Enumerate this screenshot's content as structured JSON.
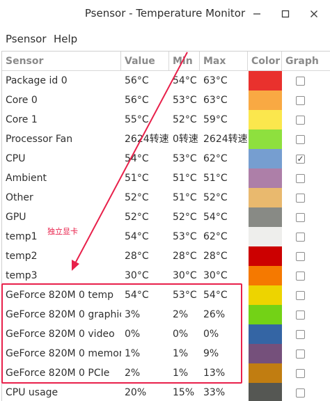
{
  "window": {
    "title": "Psensor - Temperature Monitor",
    "buttons": {
      "minimize": "minimize-icon",
      "maximize": "maximize-icon",
      "close": "close-icon"
    }
  },
  "menu": {
    "items": [
      "Psensor",
      "Help"
    ]
  },
  "table": {
    "columns": [
      "Sensor",
      "Value",
      "Min",
      "Max",
      "Color",
      "Graph"
    ],
    "rows": [
      {
        "sensor": "Package id 0",
        "value": "56°C",
        "min": "54°C",
        "max": "63°C",
        "color": "#e9312d",
        "graph": false
      },
      {
        "sensor": "Core 0",
        "value": "56°C",
        "min": "53°C",
        "max": "63°C",
        "color": "#f9a943",
        "graph": false
      },
      {
        "sensor": "Core 1",
        "value": "55°C",
        "min": "52°C",
        "max": "59°C",
        "color": "#fbe74d",
        "graph": false
      },
      {
        "sensor": "Processor Fan",
        "value": "2624转速",
        "min": "0转速",
        "max": "2624转速",
        "color": "#8ee03e",
        "graph": false
      },
      {
        "sensor": "CPU",
        "value": "54°C",
        "min": "53°C",
        "max": "62°C",
        "color": "#769ed0",
        "graph": true
      },
      {
        "sensor": "Ambient",
        "value": "51°C",
        "min": "51°C",
        "max": "51°C",
        "color": "#ad7fa8",
        "graph": false
      },
      {
        "sensor": "Other",
        "value": "52°C",
        "min": "51°C",
        "max": "52°C",
        "color": "#e9b96e",
        "graph": false
      },
      {
        "sensor": "GPU",
        "value": "52°C",
        "min": "52°C",
        "max": "54°C",
        "color": "#888a85",
        "graph": false
      },
      {
        "sensor": "temp1",
        "value": "54°C",
        "min": "53°C",
        "max": "62°C",
        "color": "#eeeeec",
        "graph": false
      },
      {
        "sensor": "temp2",
        "value": "28°C",
        "min": "28°C",
        "max": "28°C",
        "color": "#cc0000",
        "graph": false
      },
      {
        "sensor": "temp3",
        "value": "30°C",
        "min": "30°C",
        "max": "30°C",
        "color": "#f57900",
        "graph": false
      },
      {
        "sensor": "GeForce 820M 0 temp",
        "value": "54°C",
        "min": "53°C",
        "max": "54°C",
        "color": "#edd400",
        "graph": false
      },
      {
        "sensor": "GeForce 820M 0 graphics",
        "value": "3%",
        "min": "2%",
        "max": "26%",
        "color": "#73d216",
        "graph": false
      },
      {
        "sensor": "GeForce 820M 0 video",
        "value": "0%",
        "min": "0%",
        "max": "0%",
        "color": "#3465a4",
        "graph": false
      },
      {
        "sensor": "GeForce 820M 0 memory",
        "value": "1%",
        "min": "1%",
        "max": "9%",
        "color": "#75507b",
        "graph": false
      },
      {
        "sensor": "GeForce 820M 0 PCIe",
        "value": "2%",
        "min": "1%",
        "max": "13%",
        "color": "#c17d11",
        "graph": false
      },
      {
        "sensor": "CPU usage",
        "value": "20%",
        "min": "15%",
        "max": "33%",
        "color": "#555753",
        "graph": false
      }
    ]
  },
  "annotation": {
    "label": "独立显卡",
    "color": "#e8204a"
  }
}
